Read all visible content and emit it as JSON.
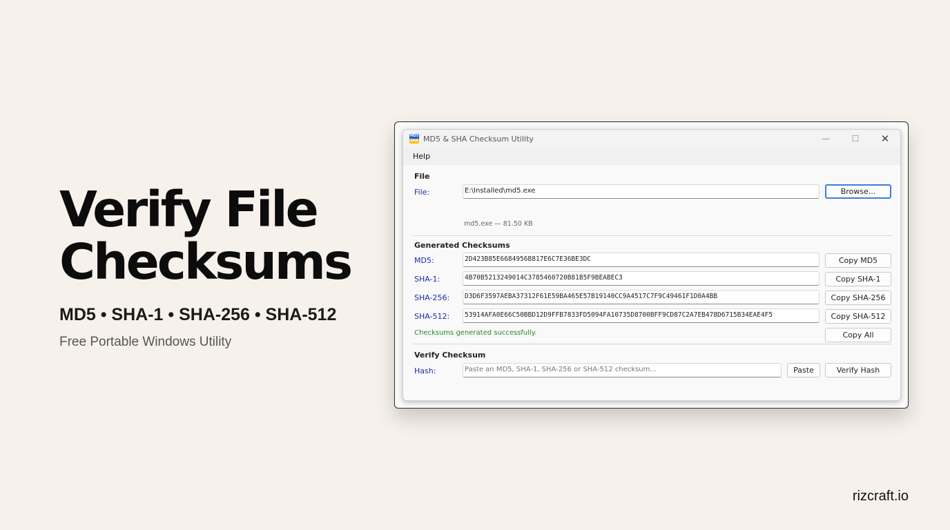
{
  "hero": {
    "title_line1": "Verify File",
    "title_line2": "Checksums",
    "subtitle": "MD5 • SHA-1 • SHA-256 • SHA-512",
    "note": "Free Portable Windows Utility"
  },
  "brand": "rizcraft.io",
  "window": {
    "title": "MD5 & SHA Checksum Utility",
    "icon_label": "MD5 SHA",
    "controls": {
      "minimize": "—",
      "maximize": "☐",
      "close": "✕"
    },
    "menu": [
      "Help"
    ]
  },
  "file_section": {
    "heading": "File",
    "label": "File:",
    "value": "E:\\Installed\\md5.exe",
    "browse_label": "Browse...",
    "info": "md5.exe  —  81.50 KB"
  },
  "checksums_section": {
    "heading": "Generated Checksums",
    "rows": [
      {
        "label": "MD5:",
        "value": "2D423B85E6684956B817E6C7E36BE3DC",
        "button": "Copy MD5"
      },
      {
        "label": "SHA-1:",
        "value": "4B70B5213249014C3785460720B81B5F9BEABEC3",
        "button": "Copy SHA-1"
      },
      {
        "label": "SHA-256:",
        "value": "D3D6F3597AEBA37312F61E59BA465E57B19140CC9A4517C7F9C49461F1D0A4BB",
        "button": "Copy SHA-256"
      },
      {
        "label": "SHA-512:",
        "value": "53914AFA0E66C50BBD12D9FFB7833FD5094FA10735D8700BFF9CD87C2A7EB478D6715B34EAE4F5",
        "button": "Copy SHA-512"
      }
    ],
    "copy_all_label": "Copy All",
    "status": "Checksums generated successfully."
  },
  "verify_section": {
    "heading": "Verify Checksum",
    "label": "Hash:",
    "placeholder": "Paste an MD5, SHA-1, SHA-256 or SHA-512 checksum...",
    "paste_label": "Paste",
    "verify_label": "Verify Hash"
  },
  "colors": {
    "background": "#f6f2eb",
    "label_blue": "#1a2ca8",
    "status_green": "#1f8a2a",
    "focus_blue": "#3b7dd8"
  }
}
